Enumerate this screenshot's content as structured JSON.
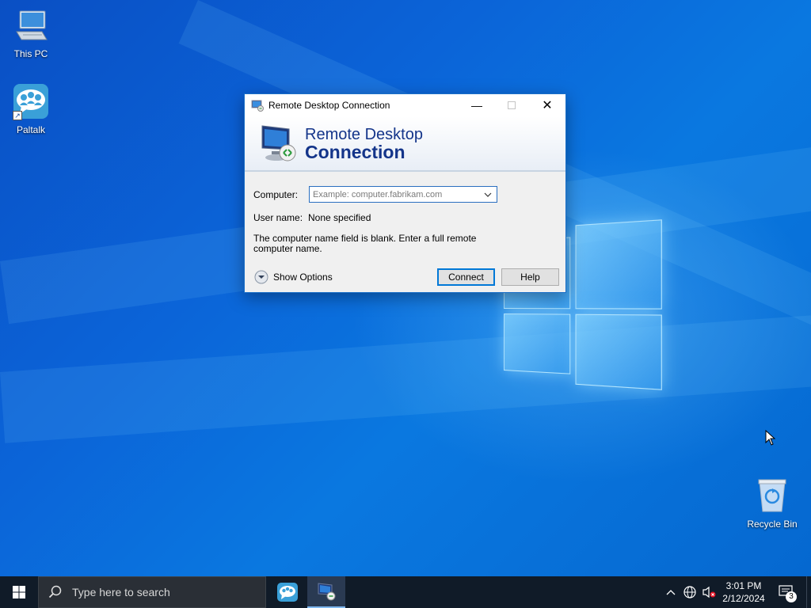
{
  "desktop": {
    "icons": [
      {
        "label": "This PC",
        "icon": "computer-icon"
      },
      {
        "label": "Paltalk",
        "icon": "paltalk-icon"
      },
      {
        "label": "Recycle Bin",
        "icon": "recycle-bin-icon"
      }
    ]
  },
  "dialog": {
    "title": "Remote Desktop Connection",
    "banner_line1": "Remote Desktop",
    "banner_line2": "Connection",
    "computer_label": "Computer:",
    "computer_placeholder": "Example: computer.fabrikam.com",
    "computer_value": "",
    "username_label": "User name:",
    "username_value": "None specified",
    "message": "The computer name field is blank. Enter a full remote computer name.",
    "show_options": "Show Options",
    "connect": "Connect",
    "help": "Help"
  },
  "taskbar": {
    "search_placeholder": "Type here to search",
    "time": "3:01 PM",
    "date": "2/12/2024",
    "notification_count": "3"
  },
  "colors": {
    "accent": "#0078d7",
    "banner_text": "#14358a",
    "taskbar": "#101b28"
  }
}
